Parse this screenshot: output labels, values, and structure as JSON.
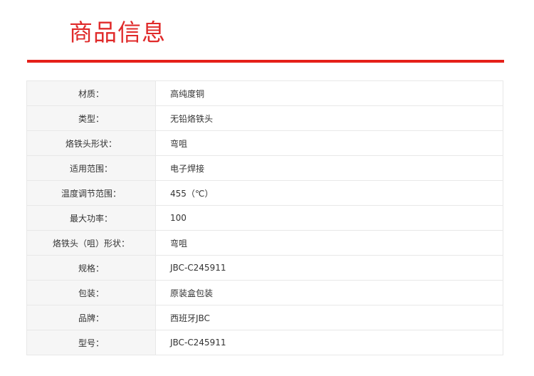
{
  "section": {
    "title": "商品信息"
  },
  "colors": {
    "accent": "#e5201a",
    "label_bg": "#f6f6f6",
    "border": "#e8e8e8"
  },
  "specs": [
    {
      "label": "材质：",
      "value": "高纯度铜"
    },
    {
      "label": "类型：",
      "value": "无铅烙铁头"
    },
    {
      "label": "烙铁头形状：",
      "value": "弯咀"
    },
    {
      "label": "适用范围：",
      "value": "电子焊接"
    },
    {
      "label": "温度调节范围：",
      "value": "455（℃）"
    },
    {
      "label": "最大功率：",
      "value": "100"
    },
    {
      "label": "烙铁头（咀）形状：",
      "value": "弯咀"
    },
    {
      "label": "规格：",
      "value": "JBC-C245911"
    },
    {
      "label": "包装：",
      "value": "原装盒包装"
    },
    {
      "label": "品牌：",
      "value": "西班牙JBC"
    },
    {
      "label": "型号：",
      "value": "JBC-C245911"
    }
  ]
}
